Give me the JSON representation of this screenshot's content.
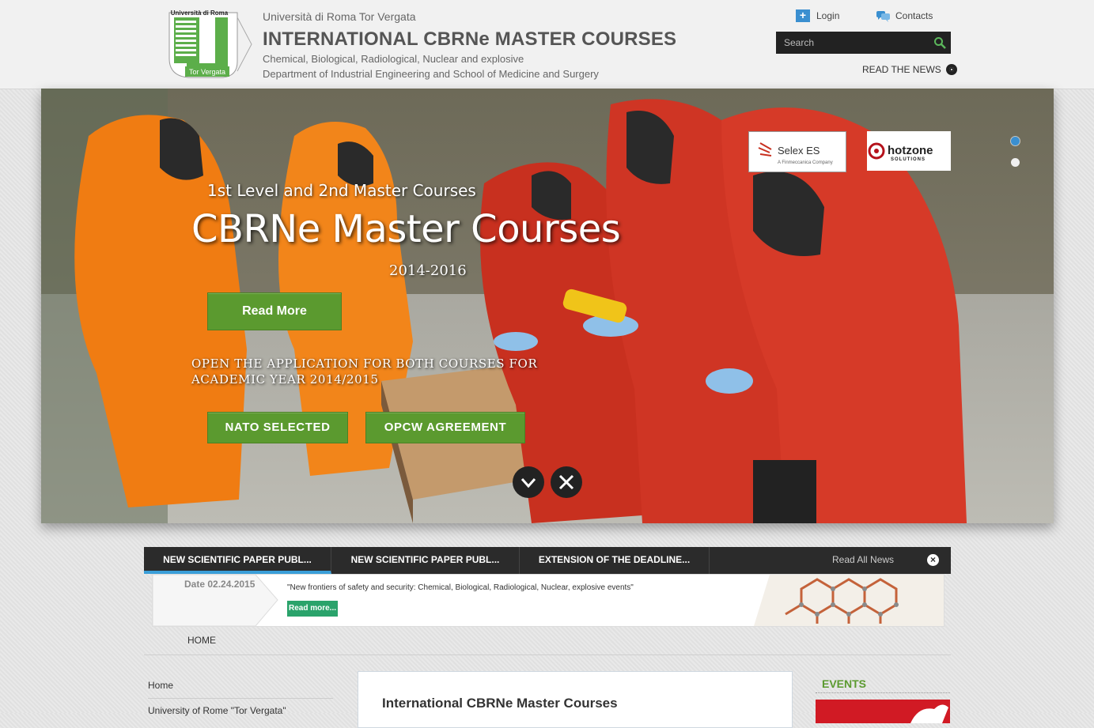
{
  "header": {
    "logo_text_top": "Università di Roma",
    "logo_text_bottom": "Tor Vergata",
    "university": "Università di Roma Tor Vergata",
    "title": "INTERNATIONAL CBRNe MASTER COURSES",
    "subtitle1": "Chemical, Biological, Radiological, Nuclear and explosive",
    "subtitle2": "Department of Industrial Engineering and School of Medicine and Surgery",
    "login_label": "Login",
    "contacts_label": "Contacts",
    "search_placeholder": "Search",
    "read_news_label": "READ THE NEWS"
  },
  "hero": {
    "subtitle": "1st Level and 2nd Master Courses",
    "title": "CBRNe Master Courses",
    "years": "2014-2016",
    "read_more_label": "Read More",
    "open_text": "OPEN THE APPLICATION FOR BOTH COURSES FOR ACADEMIC YEAR 2014/2015",
    "nato_label": "NATO SELECTED",
    "opcw_label": "OPCW AGREEMENT",
    "sponsor1": "Selex ES",
    "sponsor1_sub": "A Finmeccanica Company",
    "sponsor2": "hotzone",
    "sponsor2_sub": "SOLUTIONS"
  },
  "news": {
    "tabs": [
      {
        "label": "NEW SCIENTIFIC PAPER PUBL..."
      },
      {
        "label": "NEW SCIENTIFIC PAPER PUBL..."
      },
      {
        "label": "EXTENSION OF THE DEADLINE..."
      }
    ],
    "read_all_label": "Read All News",
    "date": "Date 02.24.2015",
    "text": "\"New frontiers of safety and security: Chemical, Biological, Radiological, Nuclear, explosive events\"",
    "read_more_label": "Read more..."
  },
  "breadcrumb": {
    "home": "HOME"
  },
  "left_nav": {
    "items": [
      {
        "label": "Home"
      },
      {
        "label": "University of Rome \"Tor Vergata\""
      }
    ]
  },
  "content": {
    "title": "International CBRNe Master Courses"
  },
  "events": {
    "title": "EVENTS"
  },
  "colors": {
    "accent_green": "#5b9a2f",
    "accent_blue": "#3a8fd0",
    "dark_bar": "#2b2b2b"
  }
}
